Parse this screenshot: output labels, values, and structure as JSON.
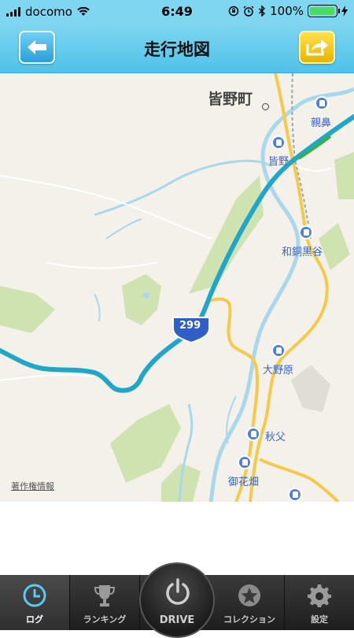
{
  "status_bar": {
    "carrier": "docomo",
    "time": "6:49",
    "battery_text": "100%",
    "battery_level": 1.0
  },
  "header": {
    "title": "走行地図",
    "back_icon": "arrow-left-icon",
    "share_icon": "share-arrow-icon"
  },
  "map": {
    "town_label": "皆野町",
    "route_badge": "299",
    "stations": [
      "親鼻",
      "皆野",
      "和銅黒谷",
      "大野原",
      "秋父",
      "御花畑"
    ],
    "copyright_link": "著作権情報",
    "route_color": "#1fa6c9",
    "road_color": "#f5c94a",
    "river_color": "#a9d8ee",
    "park_color": "#cfe3b0"
  },
  "tabs": [
    {
      "label": "ログ",
      "icon": "clock-icon",
      "active": true
    },
    {
      "label": "ランキング",
      "icon": "trophy-icon",
      "active": false
    },
    {
      "label": "DRIVE",
      "icon": "power-icon",
      "active": false
    },
    {
      "label": "コレクション",
      "icon": "star-icon",
      "active": false
    },
    {
      "label": "設定",
      "icon": "gear-icon",
      "active": false
    }
  ]
}
